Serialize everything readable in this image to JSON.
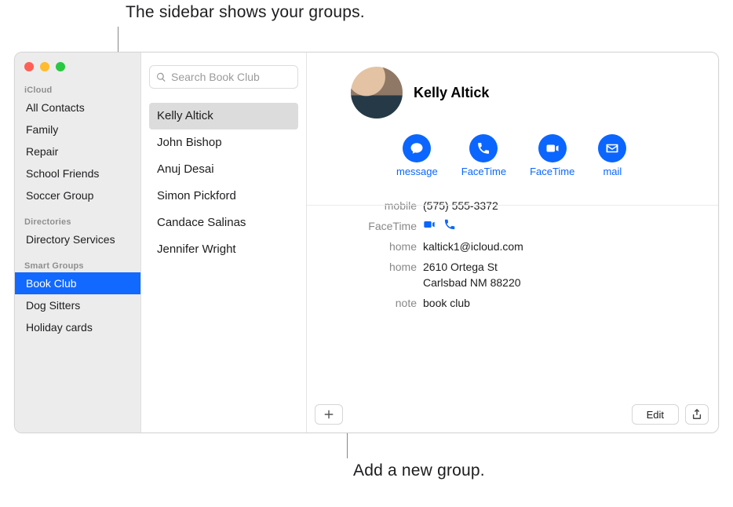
{
  "callouts": {
    "top": "The sidebar shows your groups.",
    "bottom": "Add a new group."
  },
  "sidebar": {
    "sections": [
      {
        "label": "iCloud",
        "items": [
          {
            "label": "All Contacts",
            "selected": false
          },
          {
            "label": "Family",
            "selected": false
          },
          {
            "label": "Repair",
            "selected": false
          },
          {
            "label": "School Friends",
            "selected": false
          },
          {
            "label": "Soccer Group",
            "selected": false
          }
        ]
      },
      {
        "label": "Directories",
        "items": [
          {
            "label": "Directory Services",
            "selected": false
          }
        ]
      },
      {
        "label": "Smart Groups",
        "items": [
          {
            "label": "Book Club",
            "selected": true
          },
          {
            "label": "Dog Sitters",
            "selected": false
          },
          {
            "label": "Holiday cards",
            "selected": false
          }
        ]
      }
    ]
  },
  "list": {
    "searchPlaceholder": "Search Book Club",
    "contacts": [
      {
        "name": "Kelly Altick",
        "selected": true
      },
      {
        "name": "John Bishop",
        "selected": false
      },
      {
        "name": "Anuj Desai",
        "selected": false
      },
      {
        "name": "Simon Pickford",
        "selected": false
      },
      {
        "name": "Candace Salinas",
        "selected": false
      },
      {
        "name": "Jennifer Wright",
        "selected": false
      }
    ]
  },
  "detail": {
    "name": "Kelly Altick",
    "actions": [
      {
        "label": "message",
        "icon": "message-icon"
      },
      {
        "label": "FaceTime",
        "icon": "phone-icon"
      },
      {
        "label": "FaceTime",
        "icon": "video-icon"
      },
      {
        "label": "mail",
        "icon": "mail-icon"
      }
    ],
    "fields": {
      "mobile": {
        "label": "mobile",
        "value": "(575) 555-3372"
      },
      "facetime": {
        "label": "FaceTime"
      },
      "email": {
        "label": "home",
        "value": "kaltick1@icloud.com"
      },
      "address": {
        "label": "home",
        "value": "2610 Ortega St\nCarlsbad NM 88220"
      },
      "note": {
        "label": "note",
        "value": "book club"
      }
    },
    "editLabel": "Edit"
  }
}
